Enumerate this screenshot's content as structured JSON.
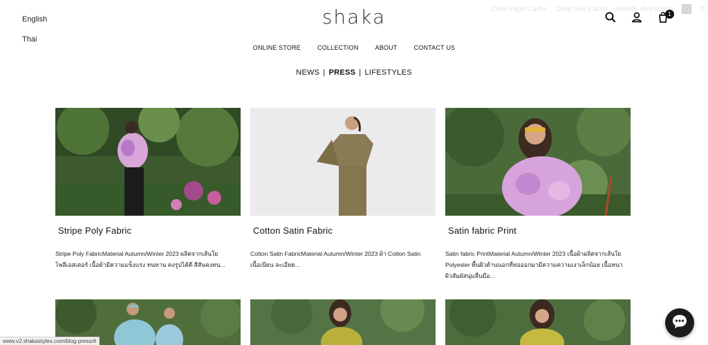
{
  "languages": [
    "English",
    "Thai"
  ],
  "brand": {
    "logo": "shaka"
  },
  "admin_bar": {
    "clear_page_cache": "Clear Page Cache",
    "clear_site_cache": "Clear Site Cache",
    "howdy": "Howdy, dev-team6"
  },
  "cart": {
    "count": "1"
  },
  "nav": [
    "ONLINE STORE",
    "COLLECTION",
    "ABOUT",
    "CONTACT US"
  ],
  "subnav": {
    "items": [
      "NEWS",
      "PRESS",
      "LIFESTYLES"
    ],
    "separator": "|",
    "active": "PRESS"
  },
  "posts": [
    {
      "title": "Stripe Poly Fabric",
      "excerpt": "Stripe Poly FabricMaterial Autumn/Winter 2023 ผลิตจากเส้นใยโพลีเอสเตอร์ เนื้อผ้ามีความแข็งแรง ทนทาน คงรูปได้ดี สีสันคงทน..."
    },
    {
      "title": "Cotton Satin Fabric",
      "excerpt": "Cotton Satin FabricMaterial Autumn/Winter 2023  ผ้า Cotton Satin เนื้อเนียน ละเอียด..."
    },
    {
      "title": "Satin fabric Print",
      "excerpt": "Satin fabric PrintMaterial Autumn/Winter 2023  เนื้อผ้าผลิตจากเส้นใย Polyester พื้นผิวด้านนอกที่ทอออกมามีความความเงาเล็กน้อย เนื้อหนา ผิวสัมผัสนุ่มลื่นมือ..."
    }
  ],
  "status_url": "www.v2.shakastyles.com/blog-press/#",
  "colors": {
    "text": "#111111",
    "admin_text": "#e2e2e2",
    "chat_button": "#1b1b1b"
  }
}
